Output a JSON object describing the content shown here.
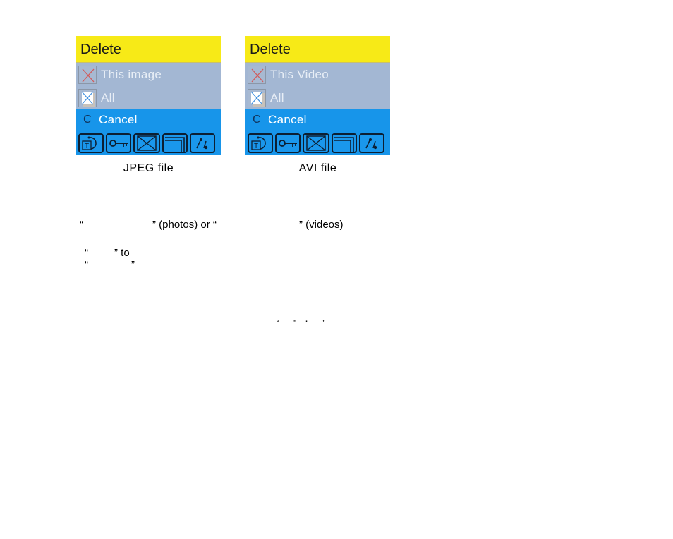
{
  "figures": [
    {
      "header": "Delete",
      "options": [
        {
          "icon": "single-delete-icon",
          "label": "This image"
        },
        {
          "icon": "all-delete-icon",
          "label": "All"
        }
      ],
      "cancel": {
        "key": "C",
        "label": "Cancel"
      },
      "toolbar_icons": [
        "text-rotate-icon",
        "key-lock-icon",
        "delete-box-icon",
        "layers-icon",
        "edit-pen-icon"
      ],
      "caption": "JPEG file"
    },
    {
      "header": "Delete",
      "options": [
        {
          "icon": "single-delete-icon",
          "label": "This Video"
        },
        {
          "icon": "all-delete-icon",
          "label": "All"
        }
      ],
      "cancel": {
        "key": "C",
        "label": "Cancel"
      },
      "toolbar_icons": [
        "text-rotate-icon",
        "key-lock-icon",
        "delete-box-icon",
        "layers-icon",
        "edit-pen-icon"
      ],
      "caption": "AVI file"
    }
  ],
  "body_text": {
    "line1_q1": "“",
    "line1_q2": "” (photos) or “",
    "line1_q3": "” (videos)",
    "line2_q1": "“",
    "line2_q2": "” to",
    "line3_q1": "“",
    "line3_q2": "”",
    "line4": "“      ”    “      ”"
  },
  "colors": {
    "header_yellow": "#f7ea17",
    "option_gray": "#a3b7d3",
    "highlight_blue": "#1795ea"
  }
}
